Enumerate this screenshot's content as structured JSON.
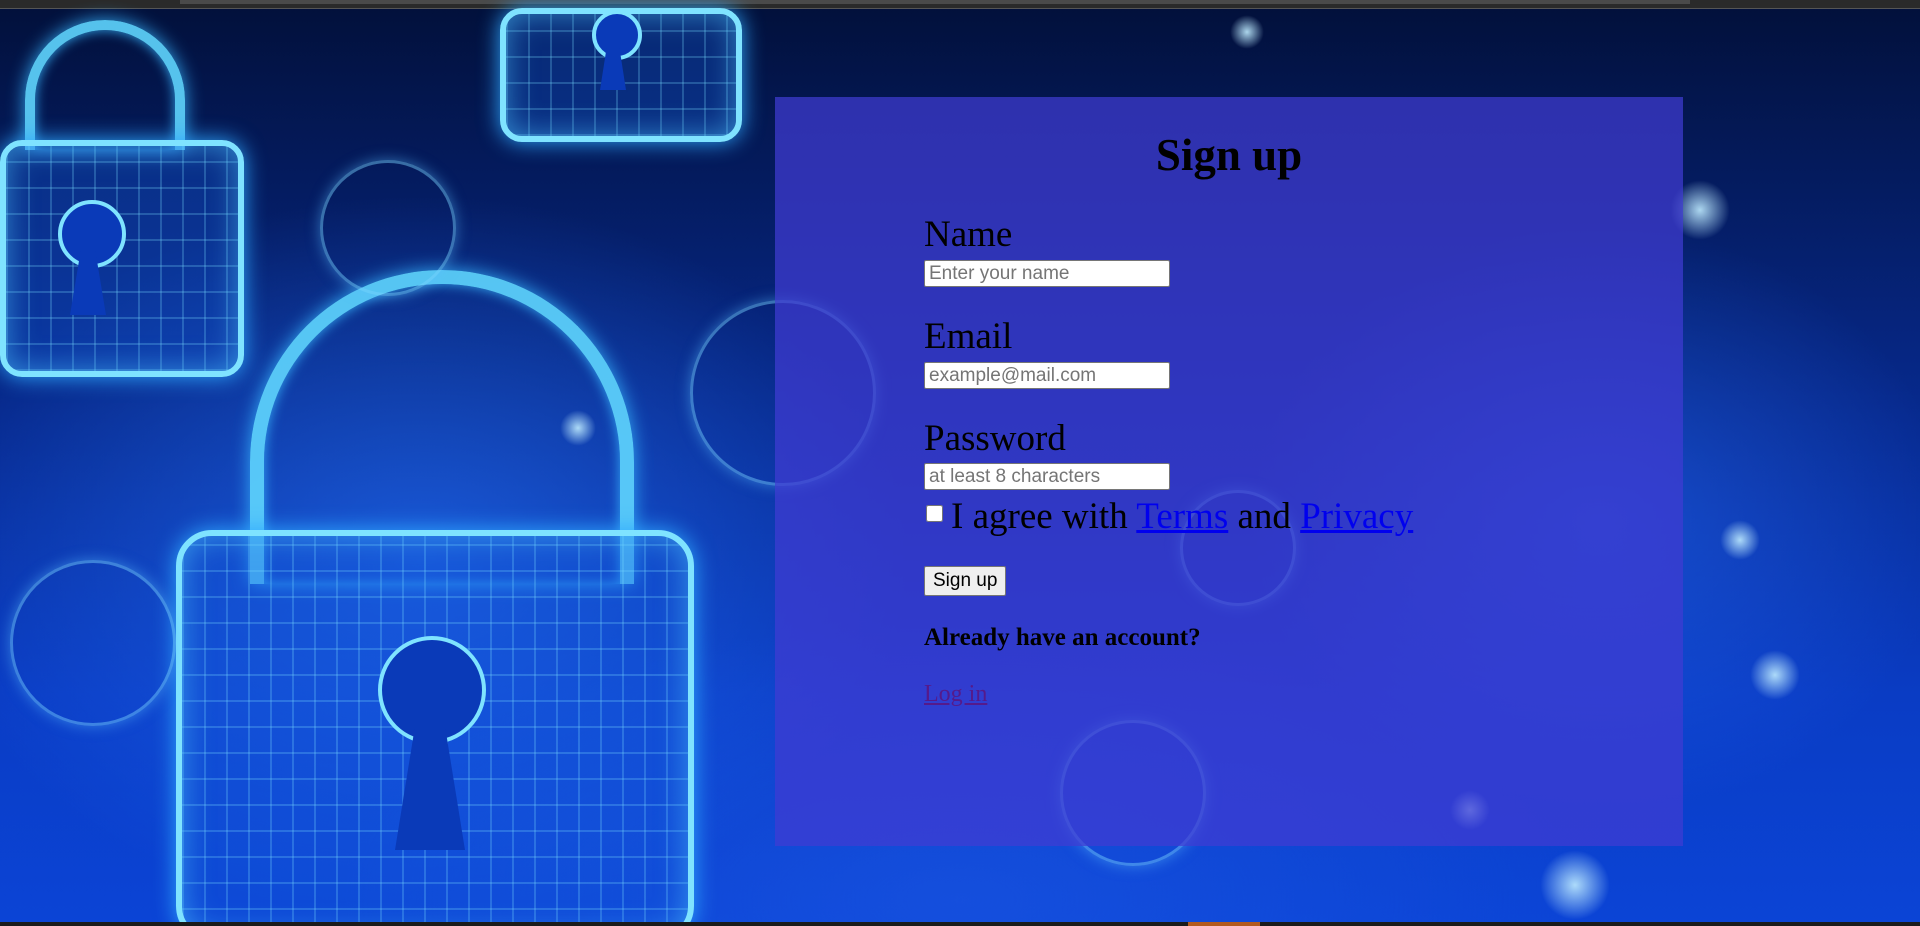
{
  "form": {
    "title": "Sign up",
    "name": {
      "label": "Name",
      "value": "",
      "placeholder": "Enter your name"
    },
    "email": {
      "label": "Email",
      "value": "",
      "placeholder": "example@mail.com"
    },
    "password": {
      "label": "Password",
      "value": "",
      "placeholder": "at least 8 characters"
    },
    "agree": {
      "checked": false,
      "prefix": "I agree with",
      "terms_link": "Terms",
      "conjunction": "and",
      "privacy_link": "Privacy"
    },
    "submit_label": "Sign up",
    "already_text": "Already have an account?",
    "login_link": "Log in"
  },
  "colors": {
    "panel": "#403cd2",
    "link": "#0000ee",
    "visited_link": "#551a8b",
    "background": "#0a3cc4"
  },
  "background_image": {
    "icon": "padlock-icon"
  }
}
